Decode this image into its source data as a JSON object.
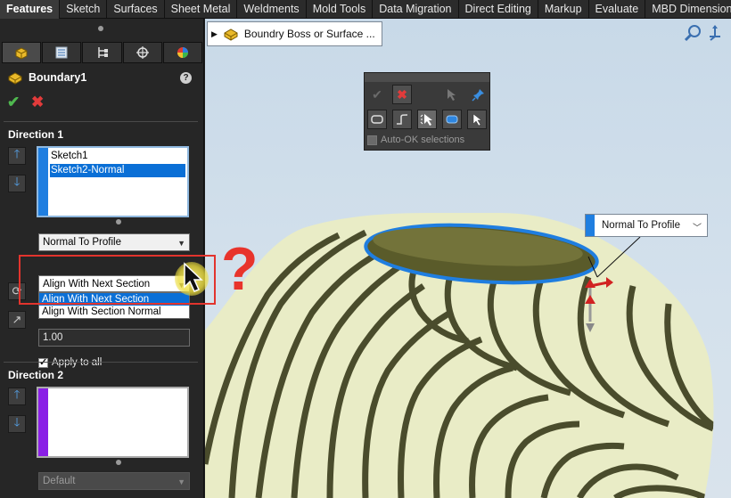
{
  "tabs": [
    {
      "label": "Features",
      "active": true
    },
    {
      "label": "Sketch"
    },
    {
      "label": "Surfaces"
    },
    {
      "label": "Sheet Metal"
    },
    {
      "label": "Weldments"
    },
    {
      "label": "Mold Tools"
    },
    {
      "label": "Data Migration"
    },
    {
      "label": "Direct Editing"
    },
    {
      "label": "Markup"
    },
    {
      "label": "Evaluate"
    },
    {
      "label": "MBD Dimensions"
    }
  ],
  "panel": {
    "feature_title": "Boundary1",
    "help_label": "?",
    "direction1": {
      "title": "Direction 1",
      "profiles": [
        {
          "label": "Sketch1",
          "selected": false
        },
        {
          "label": "Sketch2-Normal",
          "selected": true
        }
      ],
      "tangency_type": "Normal To Profile",
      "alignment_selected": "Align With Next Section",
      "alignment_options": [
        {
          "label": "Align With Next Section",
          "selected": true
        },
        {
          "label": "Align With Section Normal",
          "selected": false
        }
      ],
      "tangent_length": "1.00",
      "apply_to_all": "Apply to all"
    },
    "direction2": {
      "title": "Direction 2",
      "tangency_type": "Default"
    }
  },
  "viewport": {
    "breadcrumb": "Boundry Boss or Surface ...",
    "selection_toolbar": {
      "auto_ok_label": "Auto-OK selections"
    },
    "callout_label": "Normal To Profile",
    "annotation_mark": "?"
  },
  "colors": {
    "accent_blue": "#1f7ee0",
    "direction2_purple": "#8a1fe6",
    "highlight_red": "#e2342d",
    "model_stripe_dark": "#4a4c2c",
    "model_stripe_light": "#e9ecc6"
  }
}
